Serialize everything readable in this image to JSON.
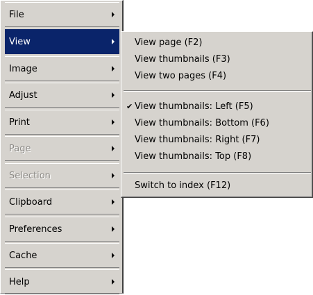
{
  "main_menu": {
    "items": [
      {
        "label": "File"
      },
      {
        "label": "View"
      },
      {
        "label": "Image"
      },
      {
        "label": "Adjust"
      },
      {
        "label": "Print"
      },
      {
        "label": "Page"
      },
      {
        "label": "Selection"
      },
      {
        "label": "Clipboard"
      },
      {
        "label": "Preferences"
      },
      {
        "label": "Cache"
      },
      {
        "label": "Help"
      }
    ]
  },
  "view_submenu": {
    "items": [
      {
        "label": "View page (F2)"
      },
      {
        "label": "View thumbnails (F3)"
      },
      {
        "label": "View two pages (F4)"
      },
      {
        "label": "View thumbnails: Left (F5)"
      },
      {
        "label": "View thumbnails: Bottom (F6)"
      },
      {
        "label": "View thumbnails: Right (F7)"
      },
      {
        "label": "View thumbnails: Top (F8)"
      },
      {
        "label": "Switch to index (F12)"
      }
    ],
    "check_glyph": "✔"
  },
  "colors": {
    "menu_background": "#d6d3ce",
    "selection_highlight": "#0a246a",
    "disabled_text": "#8c8a86"
  }
}
